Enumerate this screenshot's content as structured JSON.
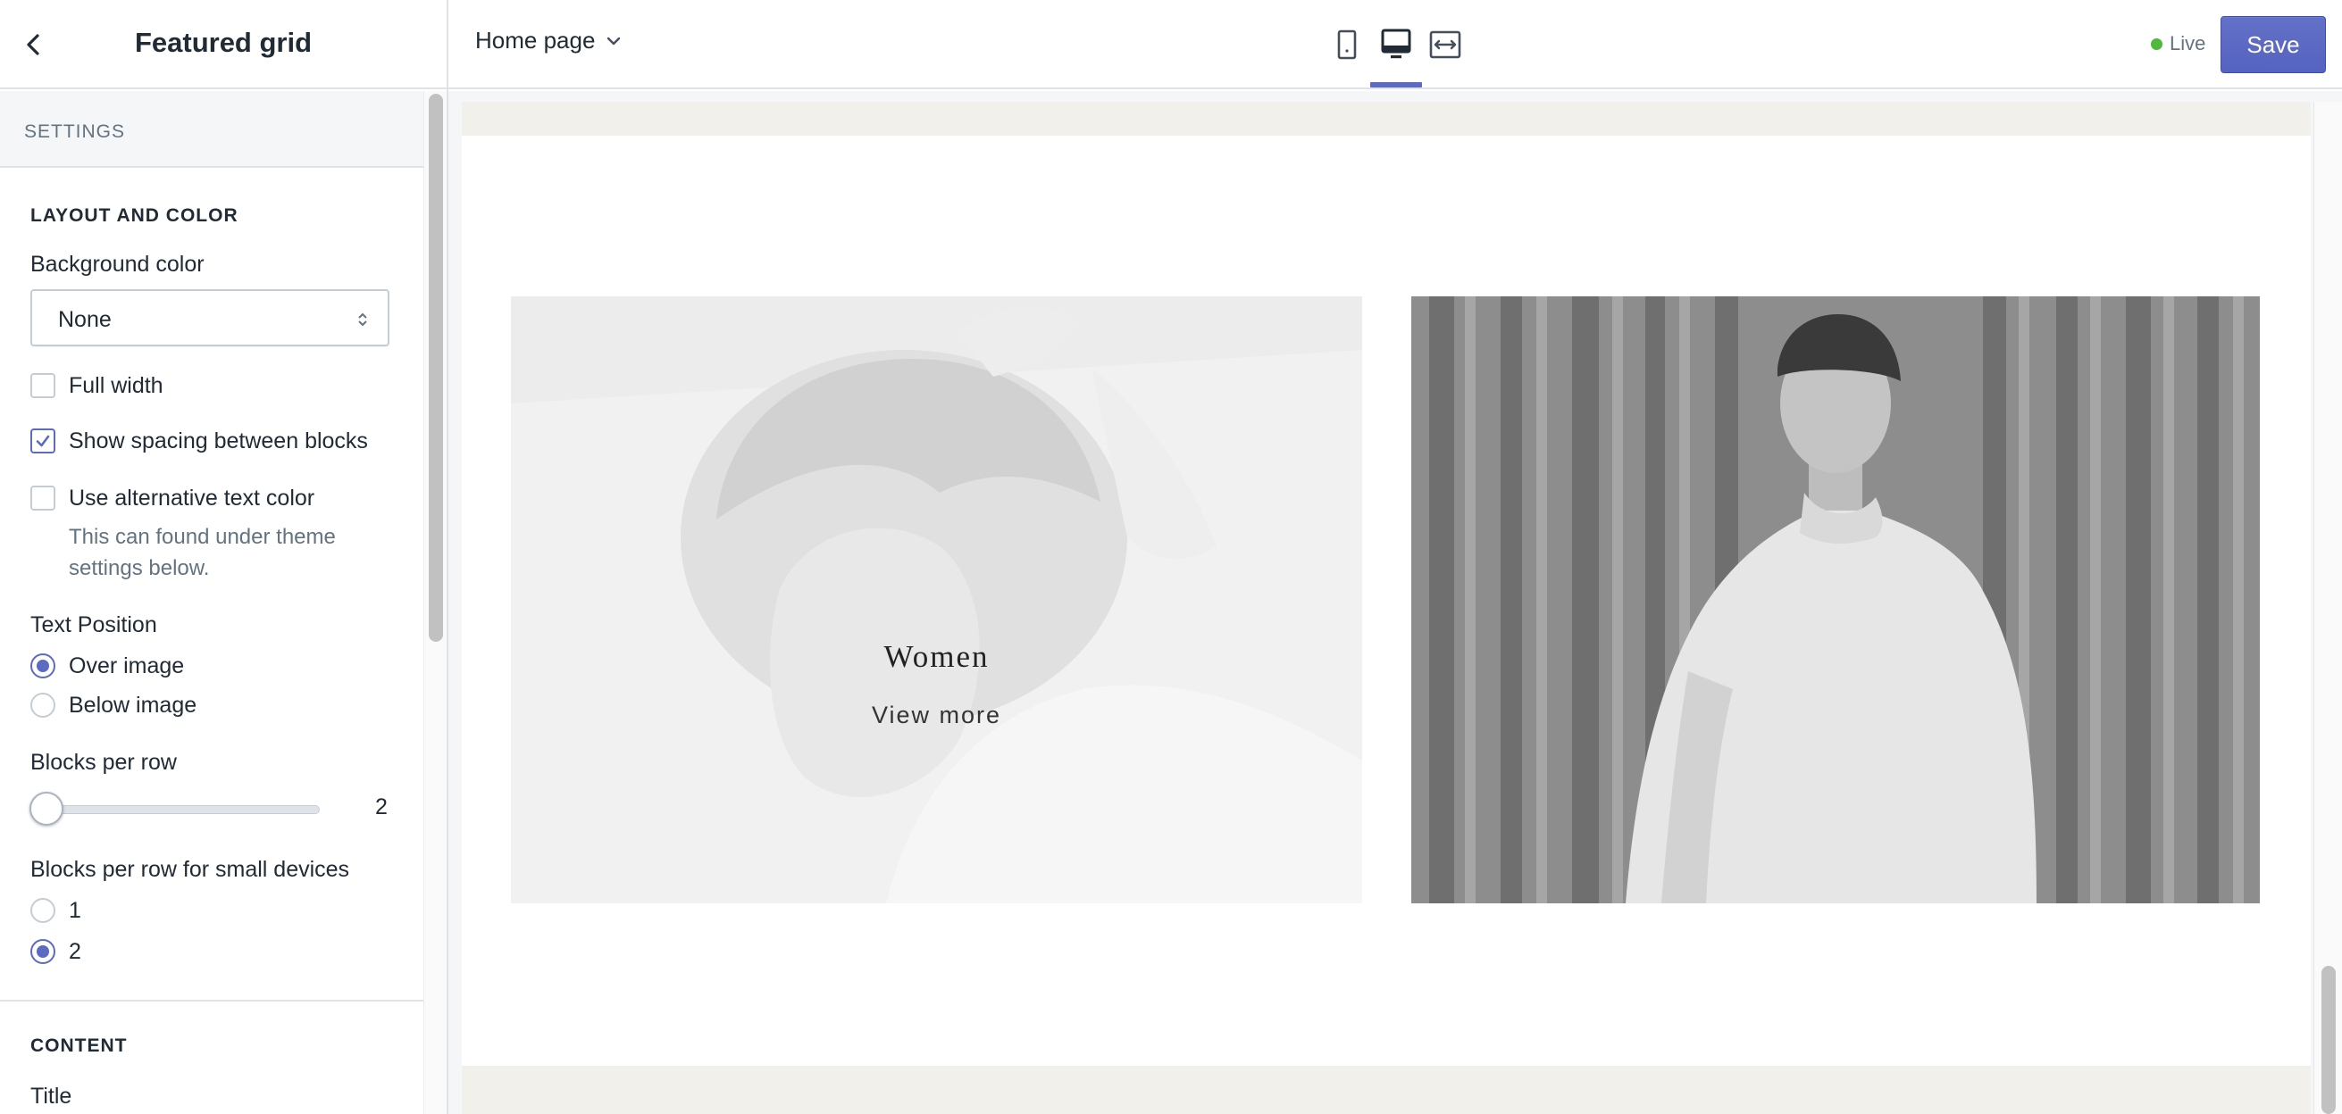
{
  "sidebar": {
    "title": "Featured grid",
    "settings_label": "SETTINGS",
    "layout_section": "LAYOUT AND COLOR",
    "background_color": {
      "label": "Background color",
      "value": "None"
    },
    "full_width": {
      "label": "Full width",
      "checked": false
    },
    "show_spacing": {
      "label": "Show spacing between blocks",
      "checked": true
    },
    "alt_text_color": {
      "label": "Use alternative text color",
      "checked": false,
      "help": "This can found under theme settings below."
    },
    "text_position": {
      "label": "Text Position",
      "options": [
        "Over image",
        "Below image"
      ],
      "selected": "Over image"
    },
    "blocks_per_row": {
      "label": "Blocks per row",
      "value": "2"
    },
    "blocks_per_row_small": {
      "label": "Blocks per row for small devices",
      "options": [
        "1",
        "2"
      ],
      "selected": "2"
    },
    "content_section": "CONTENT",
    "title_field_label": "Title"
  },
  "topbar": {
    "page_name": "Home page",
    "status": "Live",
    "save_label": "Save",
    "status_color": "#50b83c",
    "accent_color": "#5c6ac4",
    "devices": [
      "mobile-icon",
      "desktop-icon",
      "fullscreen-icon"
    ],
    "active_device": "desktop"
  },
  "preview": {
    "blocks": [
      {
        "title": "Women",
        "link": "View more"
      },
      {
        "title": "",
        "link": ""
      }
    ]
  }
}
